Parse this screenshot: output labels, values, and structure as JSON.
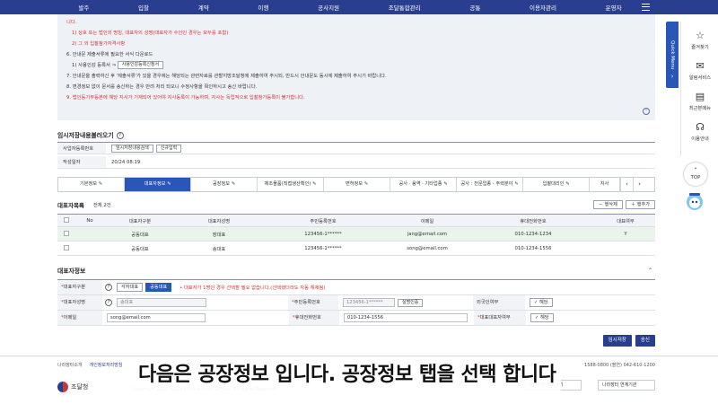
{
  "nav": [
    "발주",
    "입찰",
    "계약",
    "이행",
    "공사지원",
    "조달통합관리",
    "공통",
    "이용자관리",
    "운영자"
  ],
  "notice": {
    "l0": "니다.",
    "l1": "1) 상호 또는 법인의 명칭, 대표자의 성명(대표자가 수인인 경우는 모두를 포함)",
    "l2": "2) 그 외 입찰참가자격사항",
    "l3": "6. 안내문 제출서류에 필요한 서식 다운로드",
    "l4": "1) 사용인감 등록서 ⇒",
    "l4_btn": "사용인감등록신청서",
    "l5": "7. 안내문을 출력하신 후 '제출서류'가 있을 경우에는 해당되는 관련자료를 관할지방조달청에 제출하여 주시되, 반드시 안내문도 동시에 제출하여 주시기 바랍니다.",
    "l6": "8. 변경정보 없이 문서를 송신하는 경우 반려 처리 되오니 수정사항을 확인하시고 송신 바랍니다.",
    "l7": "9. 법인등기부등본에 해당 지사가 기재되어 있어야 지사등록이 가능하며, 지사는 독립적으로 입찰참가등록이 불가합니다."
  },
  "temp": {
    "title": "임시저장내용불러오기",
    "row1_label": "사업자등록번호",
    "btn_search": "임시저장내용검색",
    "btn_new": "신규입력",
    "row2_label": "작성일자",
    "row2_value": "20/24 08:19"
  },
  "tabs": [
    "기본정보",
    "대표자정보",
    "공장정보",
    "제조물품(직접생산확인)",
    "면허정보",
    "공사 · 용역 · 기타업종",
    "공사 : 전문업종 - 주력분야",
    "입찰대리인",
    "지사"
  ],
  "list": {
    "title": "대표자목록",
    "count": "전체 2건",
    "btn_delete": "－ 행삭제",
    "btn_add": "＋ 행추가",
    "headers": [
      "No",
      "대표자구분",
      "대표자성명",
      "주민등록번호",
      "이메일",
      "휴대전화번호",
      "대표여부"
    ],
    "rows": [
      {
        "type": "공동대표",
        "name": "장대표",
        "rrn": "123456-1******",
        "email": "jang@email.com",
        "phone": "010-1234-1234",
        "main": "Y"
      },
      {
        "type": "공동대표",
        "name": "송대표",
        "rrn": "123456-1******",
        "email": "song@email.com",
        "phone": "010-1234-1556",
        "main": ""
      }
    ]
  },
  "rep": {
    "title": "대표자정보",
    "type_label": "대표자구분",
    "opt_each": "각자대표",
    "opt_joint": "공동대표",
    "type_note": "• 대표자가 1명인 경우 선택할 필요 없습니다.(선택했더라도 자동 해제됨)",
    "name_label": "대표자성명",
    "name_value": "송대표",
    "rrn_label": "주민등록번호",
    "rrn_value": "123456-1******",
    "verify_btn": "실명인증",
    "foreign_label": "외국인여부",
    "foreign_value": "해당",
    "email_label": "이메일",
    "email_value": "song@email.com",
    "phone_label": "휴대전화번호",
    "phone_value": "010-1234-1556",
    "main_label": "대표대표자여부",
    "main_value": "해당"
  },
  "actions": {
    "temp_save": "임시저장",
    "send": "송신"
  },
  "footer": {
    "links": [
      "나라장터소개",
      "개인정보처리방침"
    ],
    "phone": "1588-0800 (팔연) 042-610-1200",
    "logo": "조달청",
    "copy": "Copyright 2023 Public Procurement Service. All Rights Reserved.",
    "sel1": "유관기관 바로가기",
    "sel2": "나라장터 연계기관"
  },
  "subtitle": "다음은 공장정보 입니다. 공장정보 탭을 선택 합니다",
  "quick_menu": "Quick Menu",
  "side": {
    "fav": "즐겨찾기",
    "alert": "알림서비스",
    "recent": "최근본메뉴",
    "guide": "이용안내",
    "top": "TOP"
  },
  "colors": {
    "navy": "#2a3e8f",
    "active": "#2a56b8",
    "red": "#d23232"
  }
}
